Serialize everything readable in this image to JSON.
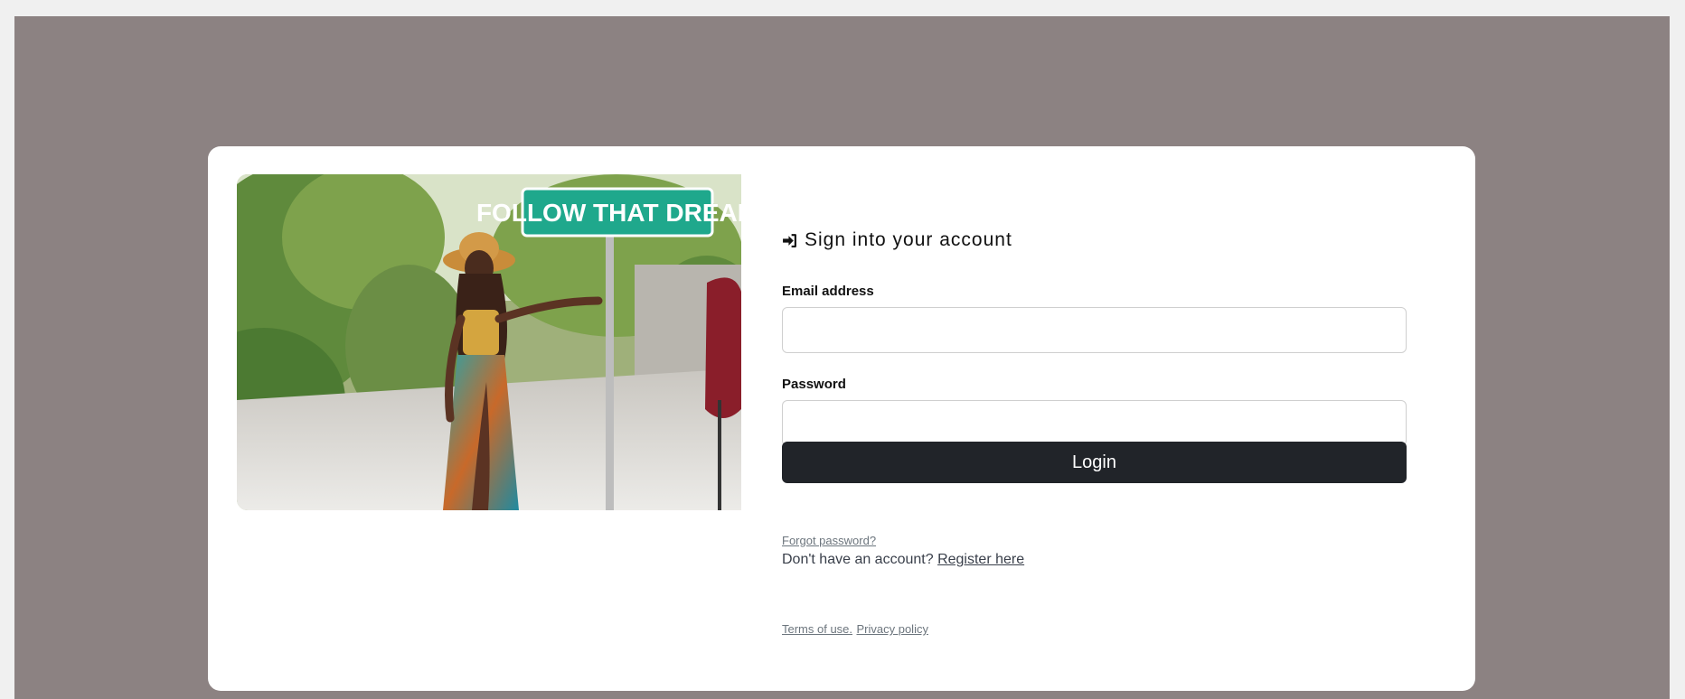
{
  "heading": {
    "icon": "sign-in-icon",
    "text": "Sign into your account"
  },
  "photo": {
    "sign_text": "FOLLOW THAT DREAM"
  },
  "form": {
    "email_label": "Email address",
    "email_value": "",
    "password_label": "Password",
    "password_value": "",
    "login_label": "Login",
    "forgot_label": "Forgot password?",
    "register_prompt": "Don't have an account?",
    "register_label": "Register here"
  },
  "footer": {
    "terms_label": "Terms of use.",
    "privacy_label": "Privacy policy"
  },
  "colors": {
    "backdrop": "#8c8282",
    "card": "#ffffff",
    "button": "#212429",
    "link": "#6c757d"
  }
}
